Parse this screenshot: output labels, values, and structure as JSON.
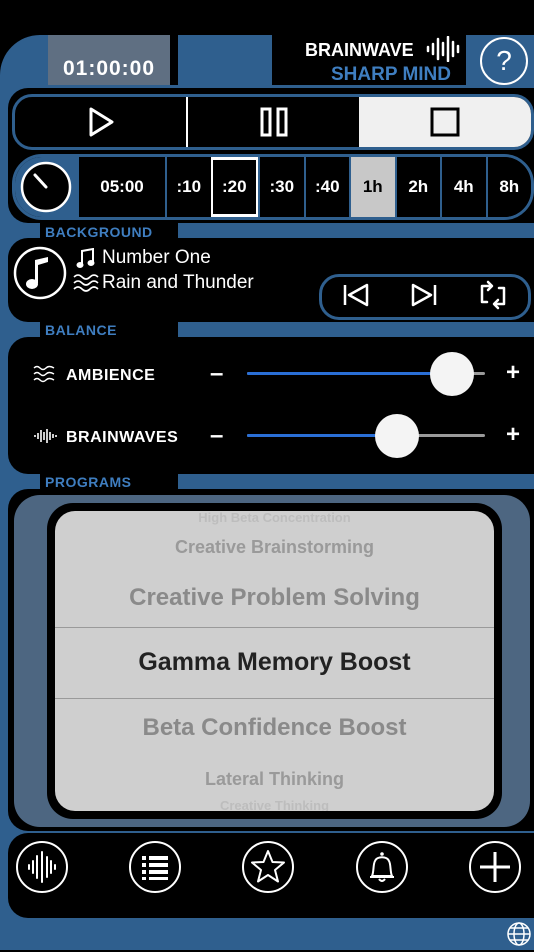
{
  "header": {
    "timer_display": "01:00:00",
    "brand_line1": "BRAINWAVE",
    "brand_line2": "SHARP MIND",
    "help_label": "?"
  },
  "transport": {
    "active": "stop"
  },
  "duration": {
    "custom": "05:00",
    "options": [
      ":10",
      ":20",
      ":30",
      ":40",
      "1h",
      "2h",
      "4h",
      "8h"
    ],
    "outlined": ":20",
    "selected": "1h"
  },
  "background": {
    "caption": "BACKGROUND",
    "music": "Number One",
    "ambience": "Rain and Thunder"
  },
  "balance": {
    "caption": "BALANCE",
    "ambience_label": "AMBIENCE",
    "ambience_level": 0.86,
    "brainwaves_label": "BRAINWAVES",
    "brainwaves_level": 0.63,
    "minus": "–",
    "plus": "+"
  },
  "programs": {
    "caption": "PROGRAMS",
    "items": [
      "High Beta Concentration",
      "Creative Brainstorming",
      "Creative Problem Solving",
      "Gamma Memory Boost",
      "Beta Confidence Boost",
      "Lateral Thinking",
      "Creative Thinking"
    ],
    "selected": "Gamma Memory Boost"
  },
  "colors": {
    "frame": "#2f5f8e",
    "accent": "#3f7ec0",
    "slider_fill": "#2a6fd6"
  }
}
